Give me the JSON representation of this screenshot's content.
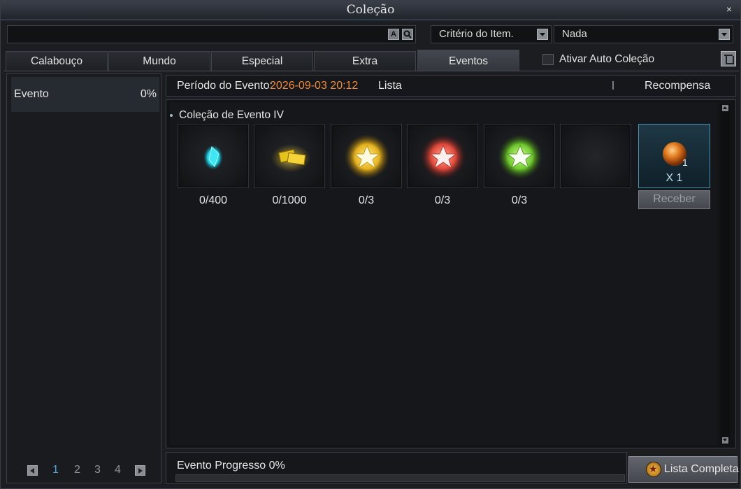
{
  "window": {
    "title": "Coleção",
    "close_icon": "×"
  },
  "search": {
    "value": "",
    "btn_a": "A",
    "btn_search": "search-icon"
  },
  "criteria_dropdown": {
    "value": "Critério do Item."
  },
  "filter_dropdown": {
    "value": "Nada"
  },
  "tabs": [
    {
      "label": "Calabouço",
      "active": false
    },
    {
      "label": "Mundo",
      "active": false
    },
    {
      "label": "Especial",
      "active": false
    },
    {
      "label": "Extra",
      "active": false
    },
    {
      "label": "Eventos",
      "active": true
    }
  ],
  "auto_collection": {
    "label": "Ativar Auto Coleção",
    "checked": false
  },
  "left_list": {
    "items": [
      {
        "label": "Evento",
        "percent": "0%"
      }
    ]
  },
  "pagination": {
    "current": "1",
    "pages": [
      "1",
      "2",
      "3",
      "4"
    ]
  },
  "event_header": {
    "period_label": "Período do Evento:",
    "period_value": "2026-09-03 20:12",
    "list_label": "Lista",
    "reward_label": "Recompensa"
  },
  "collection": {
    "title": "Coleção de Evento IV",
    "items": [
      {
        "icon": "cyan-crystal-icon",
        "progress": "0/400"
      },
      {
        "icon": "gold-tickets-icon",
        "progress": "0/1000"
      },
      {
        "icon": "gold-star-orb-icon",
        "progress": "0/3"
      },
      {
        "icon": "red-star-orb-icon",
        "progress": "0/3"
      },
      {
        "icon": "green-star-orb-icon",
        "progress": "0/3"
      },
      {
        "icon": "empty-slot",
        "progress": ""
      }
    ],
    "reward": {
      "icon": "orange-orb-icon",
      "badge": "1",
      "quantity": "X 1",
      "button": "Receber"
    }
  },
  "footer": {
    "progress_label": "Evento Progresso 0%",
    "progress_fraction": 0,
    "full_list_button": "Lista Completa"
  },
  "colors": {
    "accent_date": "#f08a38",
    "page_current": "#4ea6d6",
    "reward_border": "#4c8fb0"
  }
}
